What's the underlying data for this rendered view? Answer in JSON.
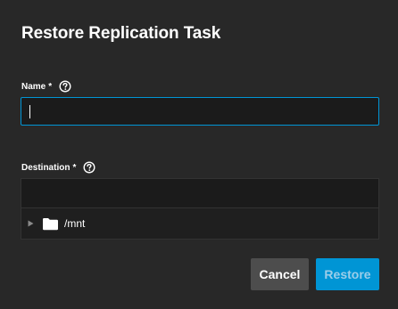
{
  "dialog": {
    "title": "Restore Replication Task"
  },
  "fields": {
    "name": {
      "label": "Name",
      "required_marker": "*",
      "value": "",
      "help_icon": "help-circle-icon"
    },
    "destination": {
      "label": "Destination",
      "required_marker": "*",
      "value": "",
      "help_icon": "help-circle-icon"
    }
  },
  "tree": {
    "nodes": [
      {
        "label": "/mnt",
        "icon": "folder-icon",
        "expanded": false
      }
    ]
  },
  "buttons": {
    "cancel_label": "Cancel",
    "restore_label": "Restore",
    "restore_enabled": false
  },
  "colors": {
    "background": "#282828",
    "accent": "#0095d5",
    "input_background": "#1b1b1b",
    "cancel_button": "#4d4d4d",
    "restore_text_disabled": "#9ccde9"
  }
}
